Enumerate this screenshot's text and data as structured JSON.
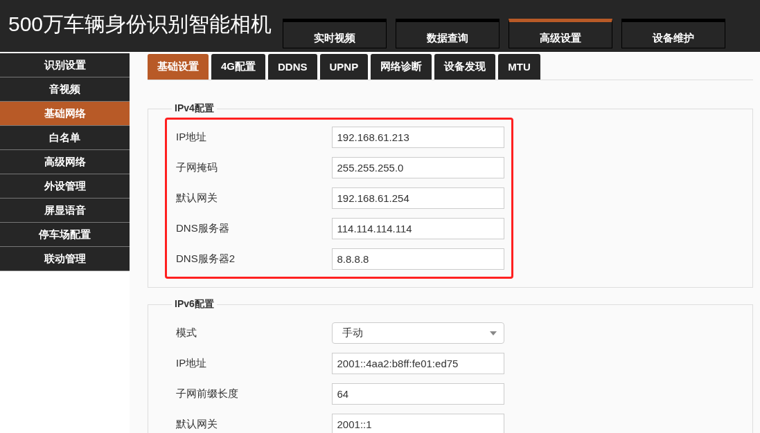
{
  "header": {
    "title": "500万车辆身份识别智能相机"
  },
  "nav_tabs": [
    {
      "label": "实时视频",
      "selected": false
    },
    {
      "label": "数据查询",
      "selected": false
    },
    {
      "label": "高级设置",
      "selected": true
    },
    {
      "label": "设备维护",
      "selected": false
    }
  ],
  "sidebar": {
    "items": [
      {
        "label": "识别设置",
        "selected": false
      },
      {
        "label": "音视频",
        "selected": false
      },
      {
        "label": "基础网络",
        "selected": true
      },
      {
        "label": "白名单",
        "selected": false
      },
      {
        "label": "高级网络",
        "selected": false
      },
      {
        "label": "外设管理",
        "selected": false
      },
      {
        "label": "屏显语音",
        "selected": false
      },
      {
        "label": "停车场配置",
        "selected": false
      },
      {
        "label": "联动管理",
        "selected": false
      }
    ]
  },
  "sub_tabs": [
    {
      "label": "基础设置",
      "selected": true
    },
    {
      "label": "4G配置",
      "selected": false
    },
    {
      "label": "DDNS",
      "selected": false
    },
    {
      "label": "UPNP",
      "selected": false
    },
    {
      "label": "网络诊断",
      "selected": false
    },
    {
      "label": "设备发现",
      "selected": false
    },
    {
      "label": "MTU",
      "selected": false
    }
  ],
  "sections": [
    {
      "legend": "IPv4配置",
      "highlighted": true,
      "fields": [
        {
          "kind": "text",
          "label": "IP地址",
          "value": "192.168.61.213"
        },
        {
          "kind": "text",
          "label": "子网掩码",
          "value": "255.255.255.0"
        },
        {
          "kind": "text",
          "label": "默认网关",
          "value": "192.168.61.254"
        },
        {
          "kind": "text",
          "label": "DNS服务器",
          "value": "114.114.114.114"
        },
        {
          "kind": "text",
          "label": "DNS服务器2",
          "value": "8.8.8.8"
        }
      ]
    },
    {
      "legend": "IPv6配置",
      "highlighted": false,
      "fields": [
        {
          "kind": "select",
          "label": "模式",
          "value": "手动"
        },
        {
          "kind": "text",
          "label": "IP地址",
          "value": "2001::4aa2:b8ff:fe01:ed75"
        },
        {
          "kind": "text",
          "label": "子网前缀长度",
          "value": "64"
        },
        {
          "kind": "text",
          "label": "默认网关",
          "value": "2001::1"
        }
      ]
    }
  ]
}
